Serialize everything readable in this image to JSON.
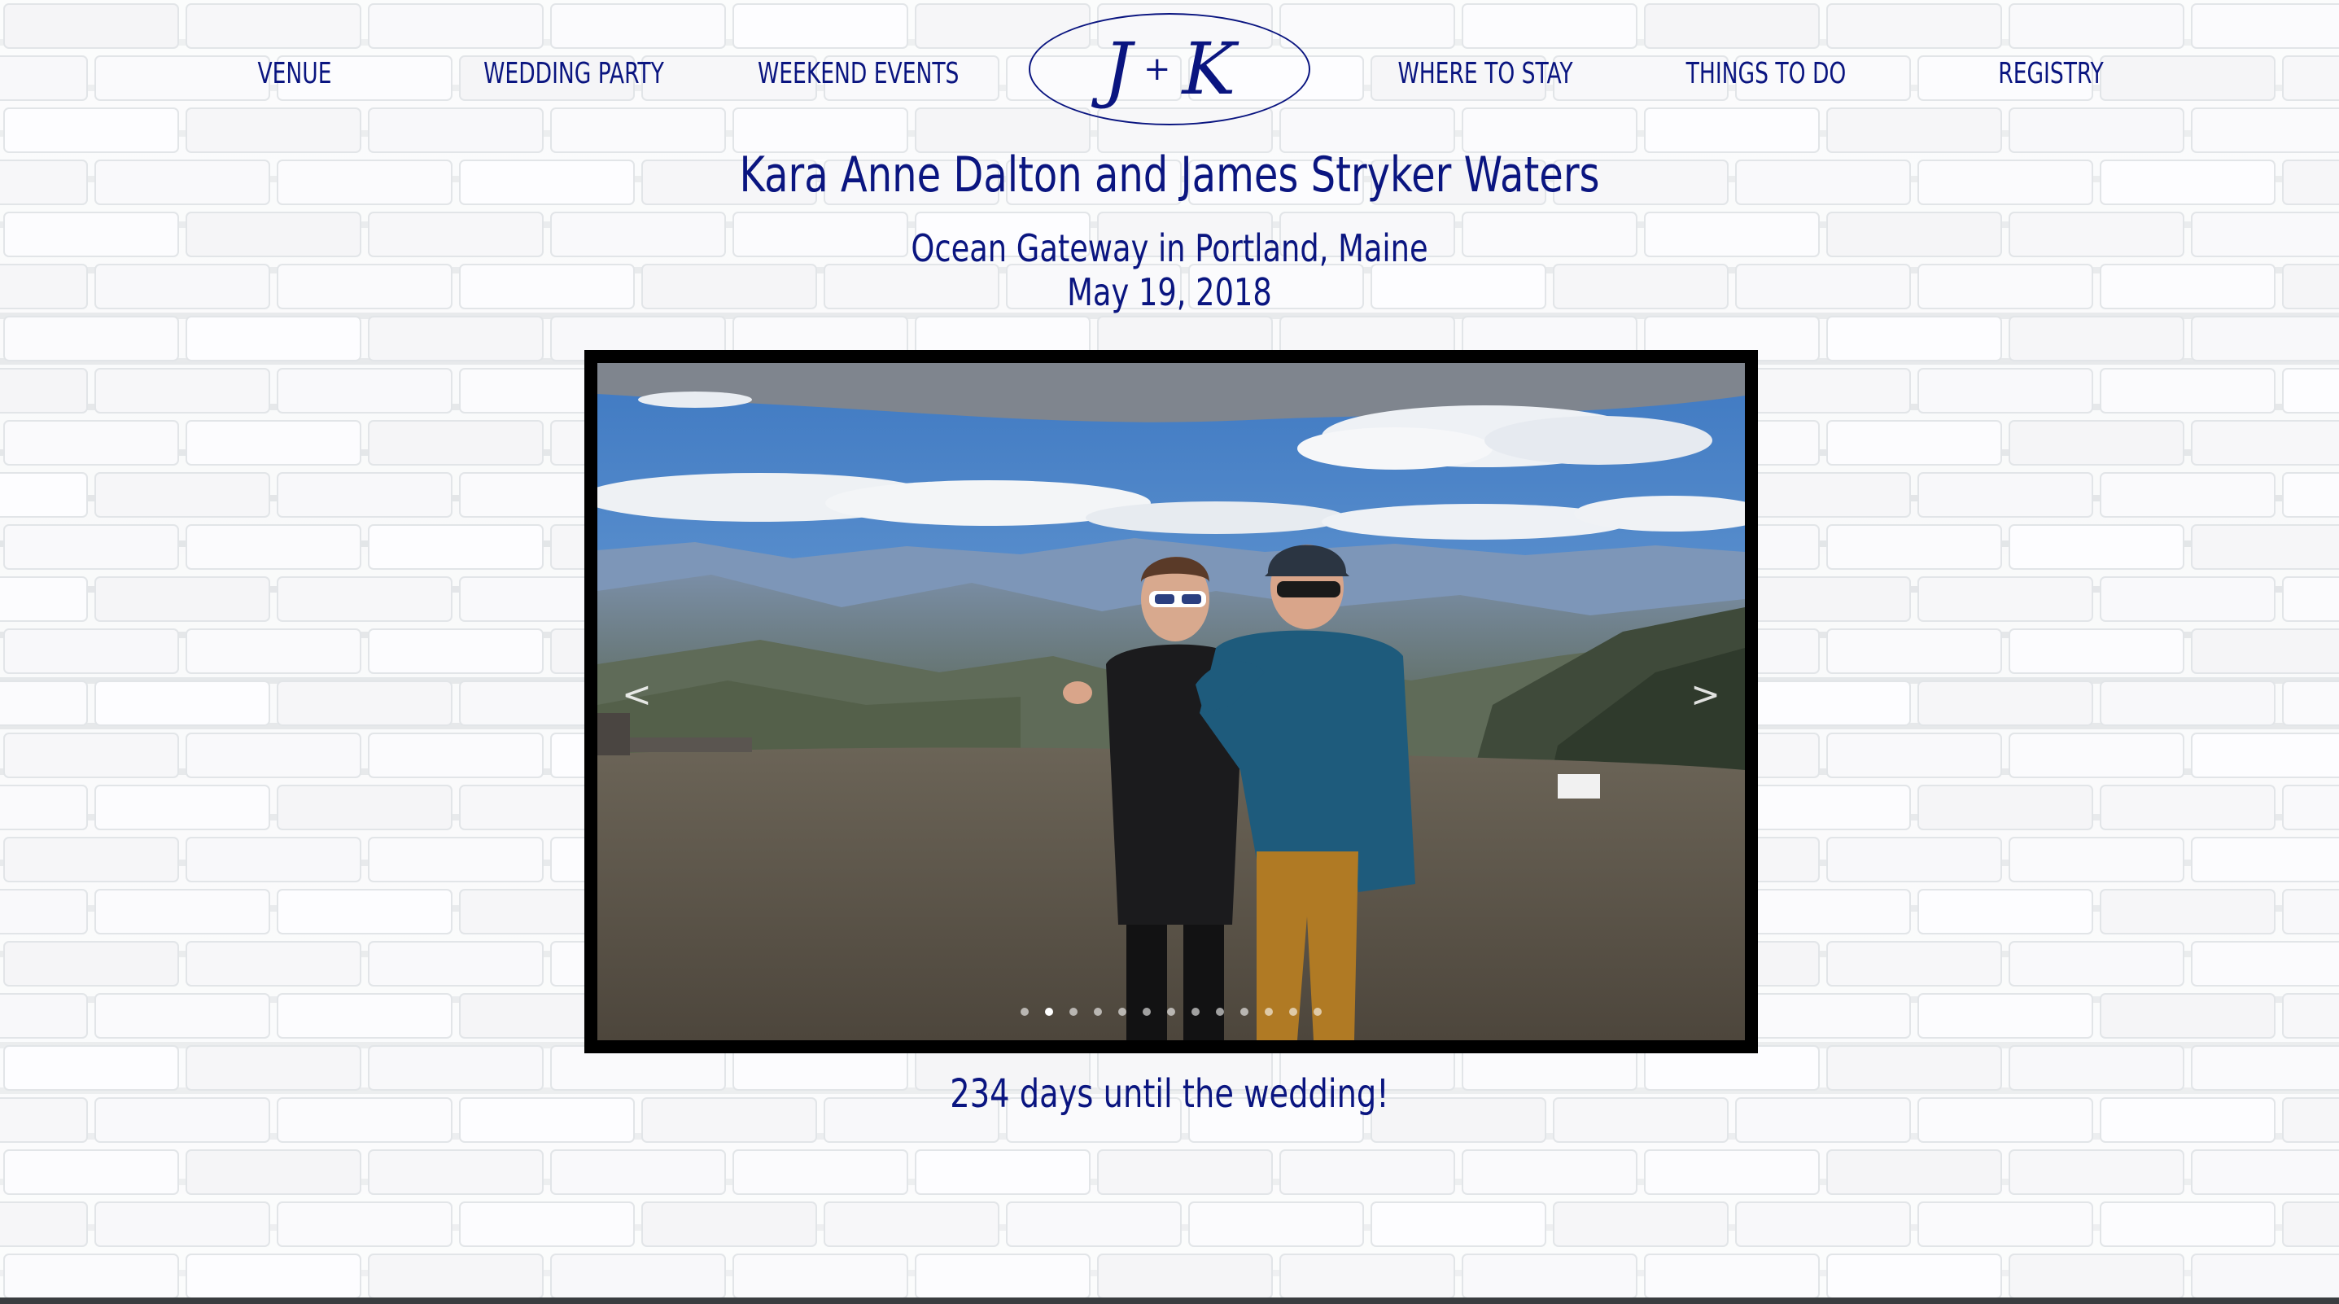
{
  "nav": {
    "items": [
      {
        "label": "VENUE"
      },
      {
        "label": "WEDDING PARTY"
      },
      {
        "label": "WEEKEND EVENTS"
      },
      {
        "label": "WHERE TO STAY"
      },
      {
        "label": "THINGS TO DO"
      },
      {
        "label": "REGISTRY"
      }
    ],
    "logo": {
      "left": "J",
      "plus": "+",
      "right": "K"
    }
  },
  "header": {
    "title": "Kara Anne Dalton and James Stryker Waters",
    "venue": "Ocean Gateway in Portland, Maine",
    "date": "May 19, 2018"
  },
  "slideshow": {
    "prev_label": "<",
    "next_label": ">",
    "slide_count": 13,
    "active_index": 1,
    "image_description_icon": "couple-mountain-photo"
  },
  "countdown": {
    "text": "234 days until the wedding!"
  },
  "colors": {
    "accent": "#0a1580",
    "frame": "#000000",
    "background": "#f4f5f6"
  }
}
